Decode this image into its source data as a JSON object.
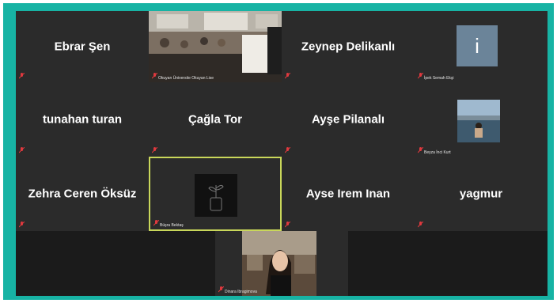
{
  "meeting": {
    "participants": [
      {
        "id": "ebrar",
        "name": "Ebrar Şen",
        "type": "name"
      },
      {
        "id": "okuyan",
        "name": "Okuyan Üniversite Okuyan Lise",
        "type": "video-classroom"
      },
      {
        "id": "zeynep",
        "name": "Zeynep Delikanlı",
        "type": "name"
      },
      {
        "id": "ipek",
        "name": "İpek Semah Ekşi",
        "type": "avatar",
        "initial": "i"
      },
      {
        "id": "tunahan",
        "name": "tunahan turan",
        "type": "name"
      },
      {
        "id": "cagla",
        "name": "Çağla Tor",
        "type": "name"
      },
      {
        "id": "ayse-p",
        "name": "Ayşe Pilanalı",
        "type": "name"
      },
      {
        "id": "beyza",
        "name": "Beyza İnci Kurt",
        "type": "photo-sea"
      },
      {
        "id": "zehra",
        "name": "Zehra Ceren Öksüz",
        "type": "name"
      },
      {
        "id": "busra",
        "name": "Büşra Bektaş",
        "type": "avatar-plant",
        "active": true
      },
      {
        "id": "ayse-i",
        "name": "Ayse Irem Inan",
        "type": "name"
      },
      {
        "id": "yagmur",
        "name": "yagmur",
        "type": "name"
      },
      {
        "id": "dinara",
        "name": "Dinara Ibragimova",
        "type": "video-person"
      }
    ]
  },
  "colors": {
    "frame": "#17b3a4",
    "tile": "#2b2b2b",
    "active_border": "#c9d75a",
    "mic_muted": "#e0393e"
  },
  "icons": {
    "mic": "microphone-muted-icon"
  }
}
